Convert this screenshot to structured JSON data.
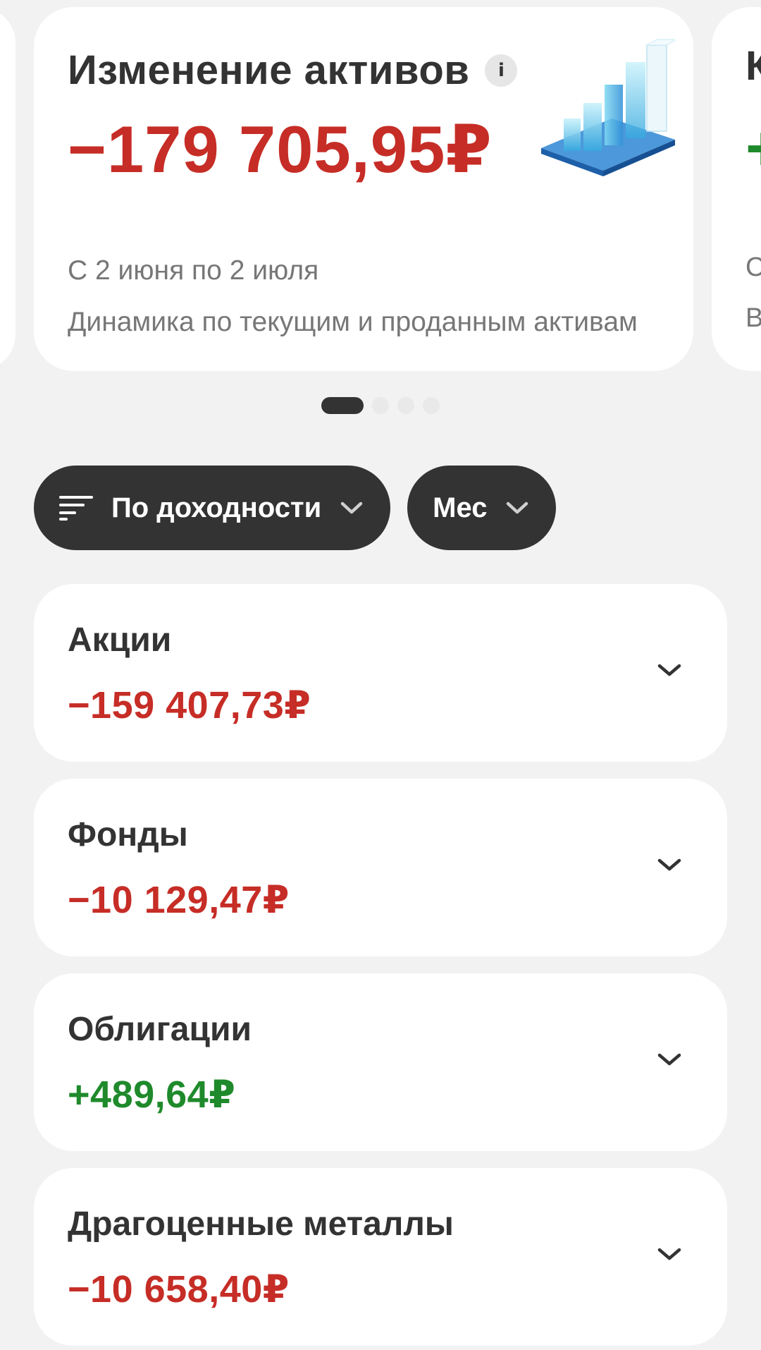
{
  "summary_card": {
    "title": "Изменение активов",
    "value": "−179 705,95₽",
    "period": "С 2 июня по 2 июля",
    "description": "Динамика по текущим и проданным активам",
    "value_color": "#c62d26",
    "icon": "bar-chart-3d-icon"
  },
  "next_card": {
    "title_initial": "К",
    "value_initial": "+",
    "line1_initial": "С",
    "line2_initial": "В",
    "value_color": "#1f8a2b"
  },
  "pagination": {
    "count": 4,
    "active_index": 0
  },
  "filters": {
    "sort_label": "По доходности",
    "period_label": "Мес"
  },
  "assets": [
    {
      "name": "Акции",
      "value": "−159 407,73₽",
      "trend": "negative"
    },
    {
      "name": "Фонды",
      "value": "−10 129,47₽",
      "trend": "negative"
    },
    {
      "name": "Облигации",
      "value": "+489,64₽",
      "trend": "positive"
    },
    {
      "name": "Драгоценные металлы",
      "value": "−10 658,40₽",
      "trend": "negative"
    }
  ],
  "colors": {
    "negative": "#c62d26",
    "positive": "#1f8a2b",
    "chip_bg": "#333333",
    "background": "#f2f2f2"
  }
}
